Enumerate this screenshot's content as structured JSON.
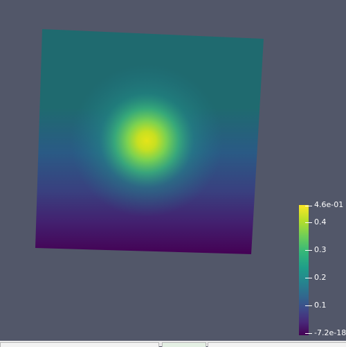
{
  "colorbar": {
    "max_label": "4.6e-01",
    "ticks": [
      "0.4",
      "0.3",
      "0.2",
      "0.1"
    ],
    "min_label": "-7.2e-18",
    "colormap": "viridis"
  },
  "scene": {
    "background_color": "#525769",
    "surface_colormap": "viridis"
  }
}
